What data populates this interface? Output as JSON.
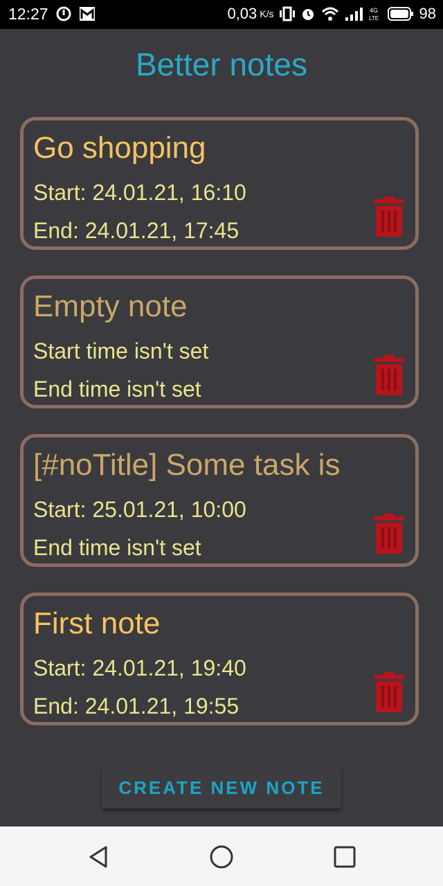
{
  "status_bar": {
    "time": "12:27",
    "speed": "0,03",
    "speed_unit": "K/s",
    "battery": "98"
  },
  "app": {
    "title": "Better notes"
  },
  "notes": [
    {
      "title": "Go shopping",
      "start": "Start: 24.01.21, 16:10",
      "end": "End: 24.01.21, 17:45"
    },
    {
      "title": "Empty note",
      "start": "Start time isn't set",
      "end": "End time isn't set"
    },
    {
      "title": "[#noTitle] Some task is",
      "start": "Start: 25.01.21, 10:00",
      "end": "End time isn't set"
    },
    {
      "title": "First note",
      "start": "Start: 24.01.21, 19:40",
      "end": "End: 24.01.21, 19:55"
    }
  ],
  "actions": {
    "create_label": "CREATE NEW NOTE"
  },
  "colors": {
    "background": "#3b3a3e",
    "title_accent": "#29a9c9",
    "note_title": "#f5c461",
    "note_text": "#e8e58e",
    "card_border": "#8a6d62",
    "delete": "#b8141c"
  },
  "icons": [
    "notification-icon",
    "gmail-icon",
    "vibrate-icon",
    "alarm-icon",
    "wifi-icon",
    "signal-icon",
    "battery-icon",
    "trash-icon",
    "back-icon",
    "home-icon",
    "recents-icon"
  ]
}
